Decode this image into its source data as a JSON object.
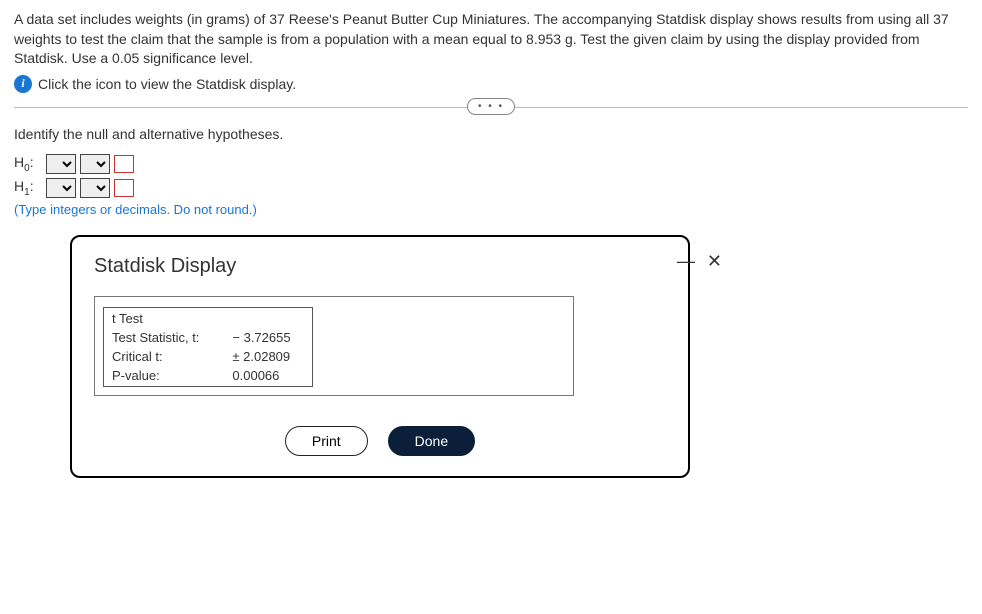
{
  "problem": {
    "text": "A data set includes weights (in grams) of 37 Reese's Peanut Butter Cup Miniatures. The accompanying Statdisk display shows results from using all 37 weights to test the claim that the sample is from a population with a mean equal to 8.953 g. Test the given claim by using the display provided from Statdisk. Use a 0.05 significance level.",
    "info_icon_glyph": "i",
    "link_text": "Click the icon to view the Statdisk display.",
    "expand_dots": "• • •"
  },
  "question": {
    "prompt": "Identify the null and alternative hypotheses.",
    "h0_label": "H",
    "h0_sub": "0",
    "h1_label": "H",
    "h1_sub": "1",
    "colon": ":",
    "hint": "(Type integers or decimals. Do not round.)"
  },
  "dialog": {
    "title": "Statdisk Display",
    "rows": [
      {
        "label": "t Test",
        "value": ""
      },
      {
        "label": "Test Statistic, t:",
        "value": "− 3.72655"
      },
      {
        "label": "Critical t:",
        "value": "± 2.02809"
      },
      {
        "label": "P-value:",
        "value": "0.00066"
      }
    ],
    "print_label": "Print",
    "done_label": "Done",
    "minimize_glyph": "—",
    "close_glyph": "✕"
  }
}
